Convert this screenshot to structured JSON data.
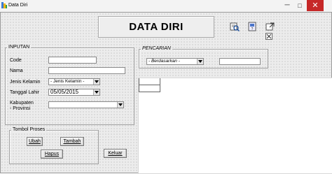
{
  "window": {
    "title": "Data Diri",
    "minimize_glyph": "─",
    "maximize_glyph": "□",
    "close_glyph": "✕"
  },
  "header": {
    "title": "DATA DIRI"
  },
  "toolbar_icons": [
    "search-record-icon",
    "print-preview-icon",
    "export-icon"
  ],
  "inputan": {
    "legend": "INPUTAN",
    "code_label": "Code",
    "code_value": "",
    "nama_label": "Nama",
    "nama_value": "",
    "jk_label": "Jenis Kelamin",
    "jk_selected": "- Jenis Kelamin -",
    "tgl_label": "Tanggal Lahir",
    "tgl_value": "05/05/2015",
    "kab_label_line1": "Kabupaten",
    "kab_label_line2": "- Provinsi",
    "kab_selected": ""
  },
  "pencarian": {
    "legend": "PENCARIAN",
    "filter_selected": "- Berdasarkan -",
    "search_value": ""
  },
  "tombol": {
    "legend": "Tombol Proses",
    "ubah": "Ubah",
    "tambah": "Tambah",
    "hapus": "Hapus",
    "keluar": "Keluar"
  }
}
